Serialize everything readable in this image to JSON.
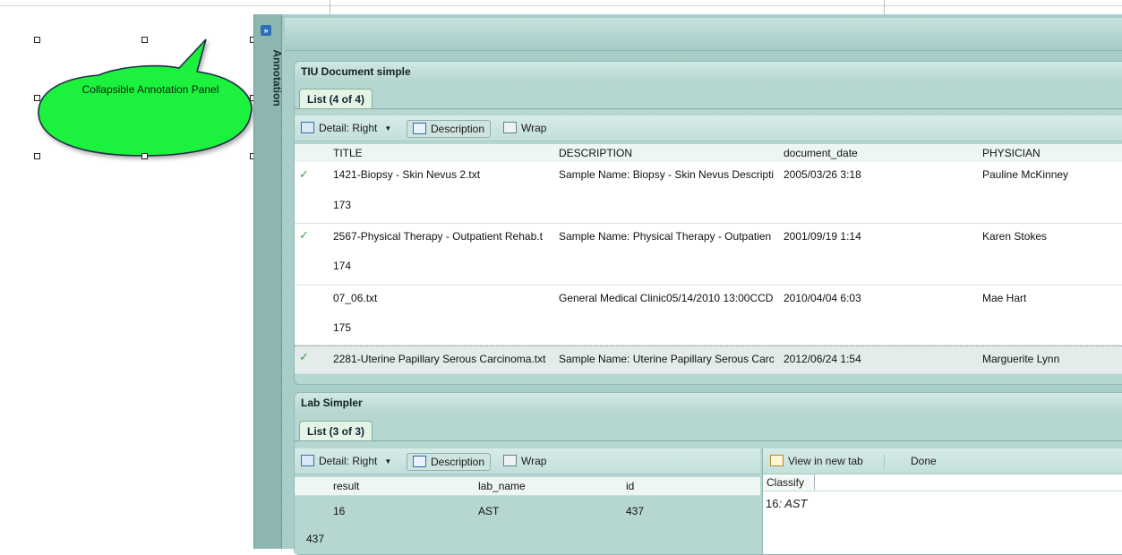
{
  "callout": {
    "text": "Collapsible Annotation Panel",
    "fill": "#1ff23c"
  },
  "sidebar": {
    "toggle_glyph": "»",
    "label": "Annotation"
  },
  "colors": {
    "panel_bg": "#b6d6d1",
    "check": "#3c9c3c",
    "tab_bg": "#e4f5e6"
  },
  "tiu": {
    "title": "TIU Document simple",
    "tab": "List (4 of 4)",
    "toolbar": {
      "detail": "Detail: Right",
      "description": "Description",
      "wrap": "Wrap"
    },
    "columns": [
      "TITLE",
      "DESCRIPTION",
      "document_date",
      "PHYSICIAN"
    ],
    "rows": [
      {
        "checked": true,
        "title": "1421-Biopsy - Skin Nevus 2.txt",
        "description": "Sample Name: Biopsy - Skin Nevus Descripti",
        "date": "2005/03/26 3:18",
        "physician": "Pauline McKinney",
        "id": "173",
        "selected": false
      },
      {
        "checked": true,
        "title": "2567-Physical Therapy - Outpatient Rehab.t",
        "description": "Sample Name: Physical Therapy - Outpatien",
        "date": "2001/09/19 1:14",
        "physician": "Karen Stokes",
        "id": "174",
        "selected": false
      },
      {
        "checked": false,
        "title": "07_06.txt",
        "description": "General Medical Clinic05/14/2010 13:00CCD",
        "date": "2010/04/04 6:03",
        "physician": "Mae Hart",
        "id": "175",
        "selected": false
      },
      {
        "checked": true,
        "title": "2281-Uterine Papillary Serous Carcinoma.txt",
        "description": "Sample Name: Uterine Papillary Serous Carc",
        "date": "2012/06/24 1:54",
        "physician": "Marguerite Lynn",
        "id": "",
        "selected": true
      }
    ]
  },
  "lab": {
    "title": "Lab Simpler",
    "tab": "List (3 of 3)",
    "toolbar": {
      "detail": "Detail: Right",
      "description": "Description",
      "wrap": "Wrap"
    },
    "columns": [
      "result",
      "lab_name",
      "id"
    ],
    "rows": [
      {
        "result": "16",
        "lab_name": "AST",
        "id": "437",
        "sub": "437"
      }
    ],
    "detail": {
      "view_new_tab": "View in new tab",
      "done": "Done",
      "classify": "Classify",
      "value": "16",
      "value_suffix": ": AST"
    }
  }
}
